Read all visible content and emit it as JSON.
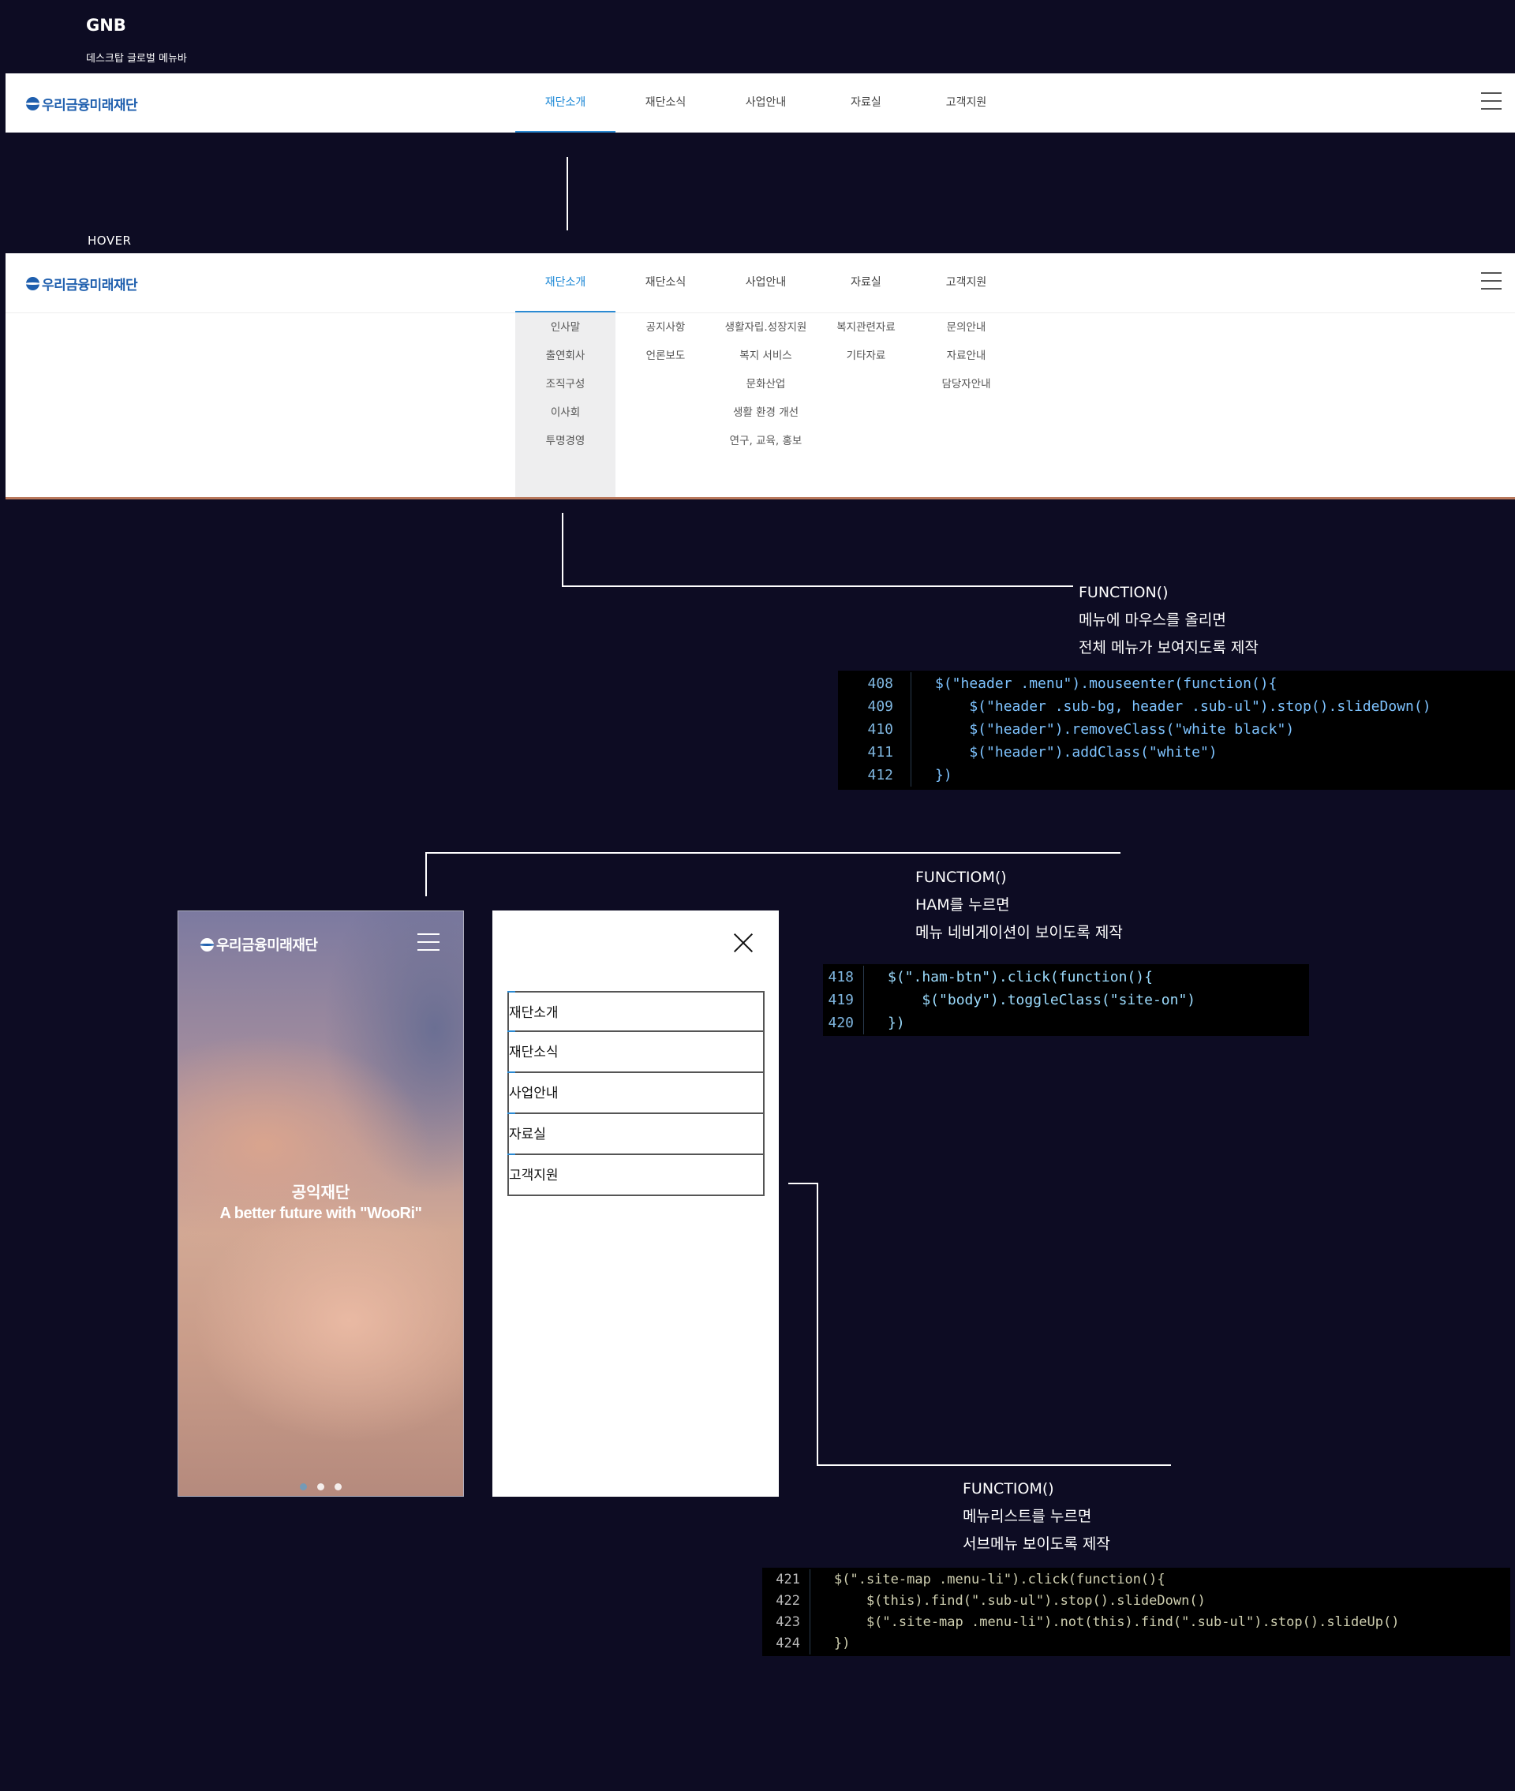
{
  "gnb_section": {
    "title": "GNB",
    "subtitle": "데스크탑 글로벌 메뉴바",
    "hover_label": "HOVER"
  },
  "header": {
    "logo_text": "우리금융미래재단",
    "nav": [
      "재단소개",
      "재단소식",
      "사업안내",
      "자료실",
      "고객지원"
    ],
    "active_index": 0
  },
  "submenu": {
    "columns": [
      [
        "인사말",
        "출연회사",
        "조직구성",
        "이사회",
        "투명경영"
      ],
      [
        "공지사항",
        "언론보도"
      ],
      [
        "생활자립.성장지원",
        "복지 서비스",
        "문화산업",
        "생활 환경 개선",
        "연구, 교육, 홍보"
      ],
      [
        "복지관련자료",
        "기타자료"
      ],
      [
        "문의안내",
        "자료안내",
        "담당자안내"
      ]
    ]
  },
  "annotations": {
    "a1": {
      "title": "FUNCTION()",
      "line1": "메뉴에 마우스를 올리면",
      "line2": "전체 메뉴가 보여지도록 제작"
    },
    "a2": {
      "title": "FUNCTIOM()",
      "line1": "HAM를 누르면",
      "line2": "메뉴 네비게이션이 보이도록 제작"
    },
    "a3": {
      "title": "FUNCTIOM()",
      "line1": "메뉴리스트를 누르면",
      "line2": "서브메뉴 보이도록 제작"
    }
  },
  "code1": {
    "lines": [
      {
        "n": "408",
        "code": "$(\"header .menu\").mouseenter(function(){"
      },
      {
        "n": "409",
        "code": "    $(\"header .sub-bg, header .sub-ul\").stop().slideDown()"
      },
      {
        "n": "410",
        "code": "    $(\"header\").removeClass(\"white black\")"
      },
      {
        "n": "411",
        "code": "    $(\"header\").addClass(\"white\")"
      },
      {
        "n": "412",
        "code": "})"
      }
    ]
  },
  "code2": {
    "lines": [
      {
        "n": "418",
        "code": "$(\".ham-btn\").click(function(){"
      },
      {
        "n": "419",
        "code": "    $(\"body\").toggleClass(\"site-on\")"
      },
      {
        "n": "420",
        "code": "})"
      }
    ]
  },
  "code3": {
    "lines": [
      {
        "n": "421",
        "code": "$(\".site-map .menu-li\").click(function(){"
      },
      {
        "n": "422",
        "code": "    $(this).find(\".sub-ul\").stop().slideDown()"
      },
      {
        "n": "423",
        "code": "    $(\".site-map .menu-li\").not(this).find(\".sub-ul\").stop().slideUp()"
      },
      {
        "n": "424",
        "code": "})"
      }
    ]
  },
  "mobile": {
    "logo_text": "우리금융미래재단",
    "hero_title": "공익재단",
    "hero_subtitle": "A better future with \"WooRi\"",
    "slide_count": 3,
    "active_slide": 0
  },
  "drawer": {
    "items": [
      "재단소개",
      "재단소식",
      "사업안내",
      "자료실",
      "고객지원"
    ]
  },
  "colors": {
    "background": "#0d0c23",
    "accent": "#2b8ad3",
    "brand": "#1f5fae"
  }
}
